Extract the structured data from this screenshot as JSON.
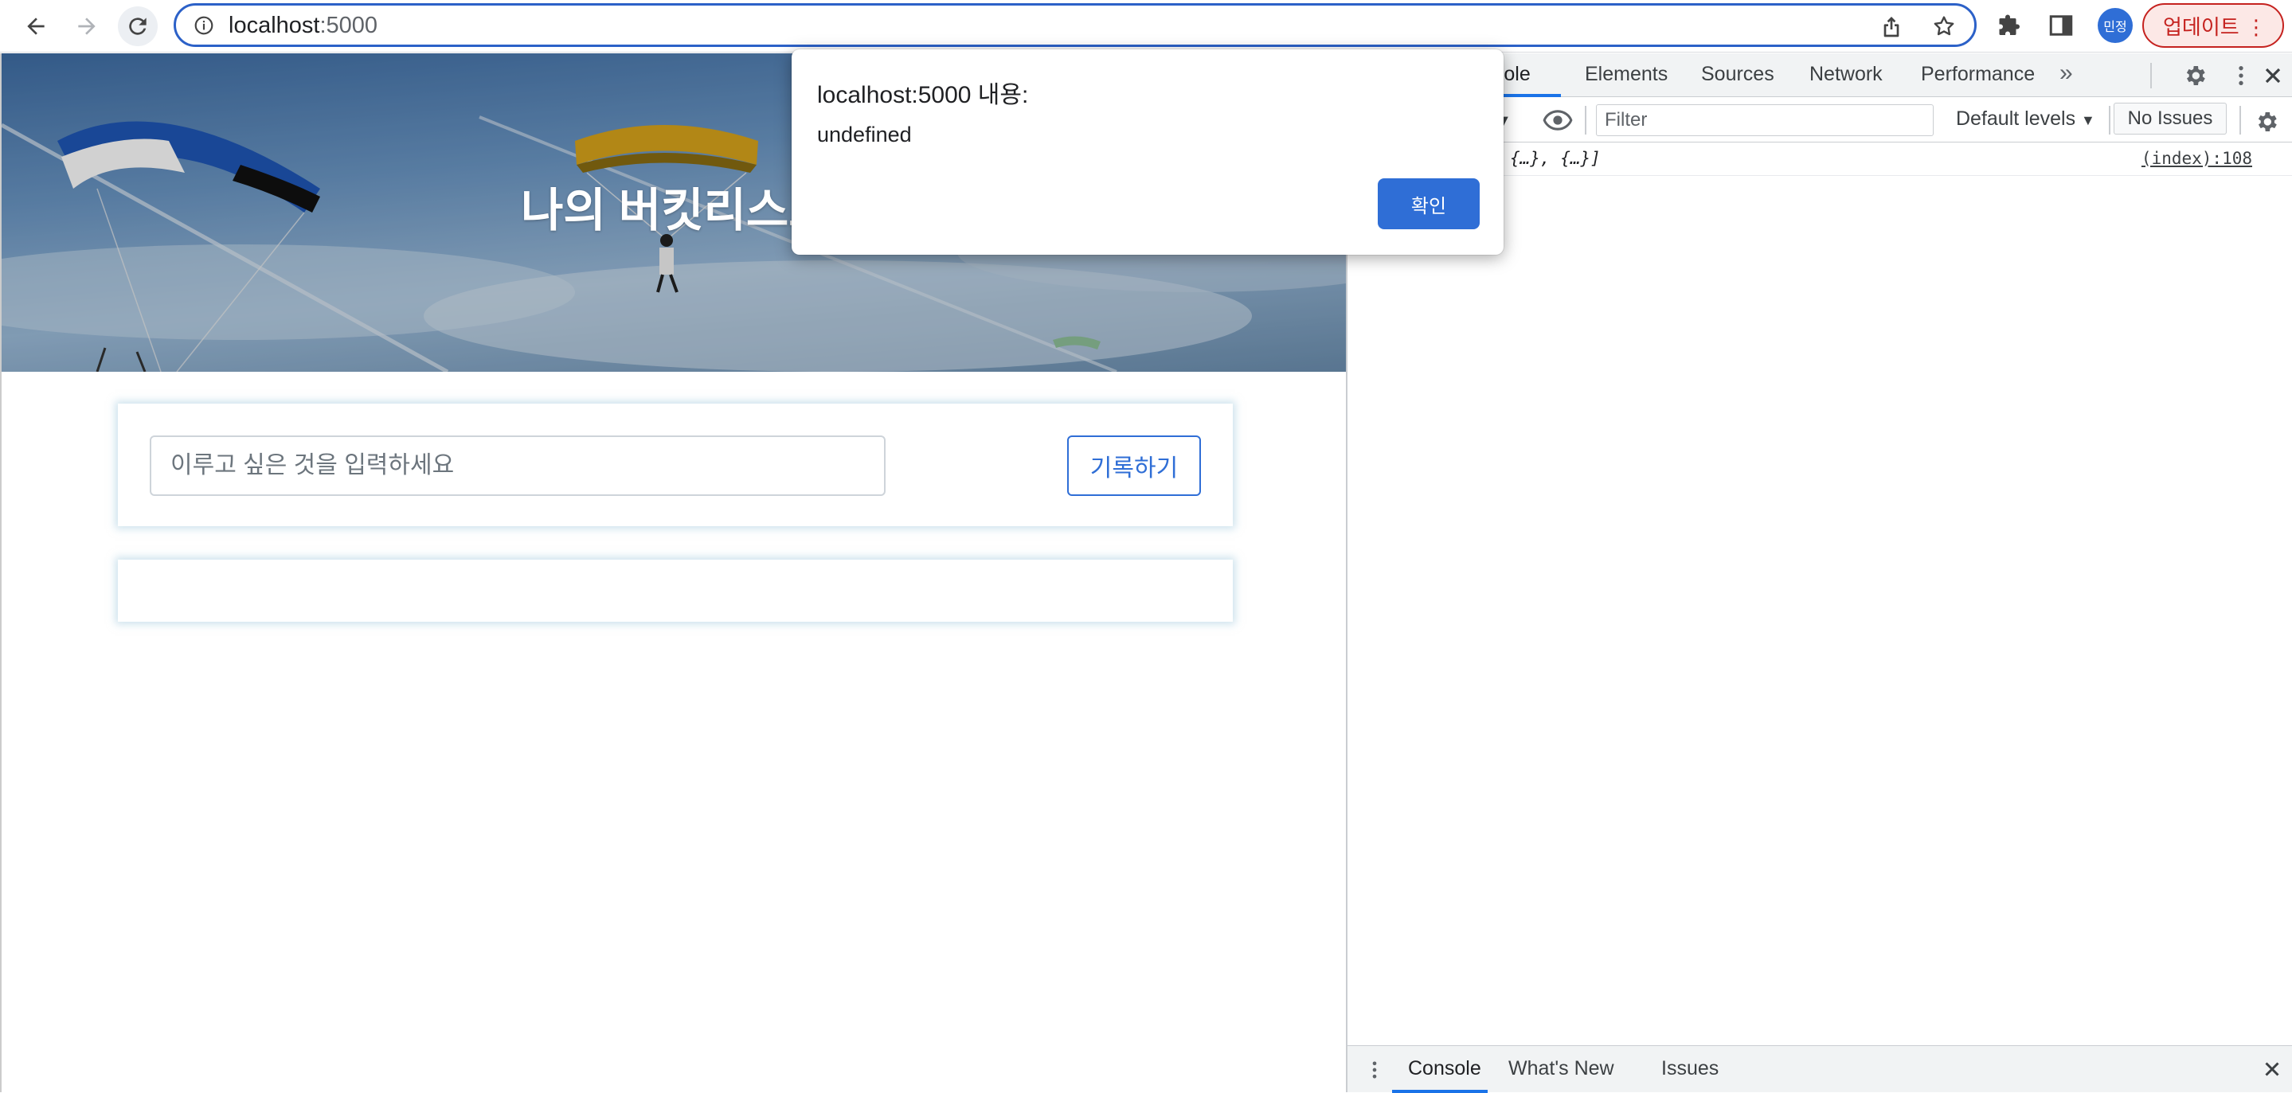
{
  "browser": {
    "url_host": "localhost",
    "url_port": ":5000",
    "profile_initials": "민정",
    "update_label": "업데이트"
  },
  "page": {
    "hero_title": "나의 버킷리스트",
    "input_placeholder": "이루고 싶은 것을 입력하세요",
    "record_button": "기록하기"
  },
  "dialog": {
    "title": "localhost:5000 내용:",
    "message": "undefined",
    "ok_label": "확인"
  },
  "devtools": {
    "tabs": [
      {
        "label": "Console",
        "visible_text": "nsole",
        "active": true
      },
      {
        "label": "Elements"
      },
      {
        "label": "Sources"
      },
      {
        "label": "Network"
      },
      {
        "label": "Performance"
      }
    ],
    "filter_placeholder": "Filter",
    "levels_label": "Default levels",
    "issues_label": "No Issues",
    "log_message": "{…}, {…}]",
    "log_source": "(index):108",
    "drawer_tabs": [
      {
        "label": "Console",
        "active": true
      },
      {
        "label": "What's New"
      },
      {
        "label": "Issues"
      }
    ]
  },
  "colors": {
    "accent": "#2f6ed6",
    "omnibox_border": "#2c61c8",
    "update_red": "#c5221f"
  },
  "icons": [
    "back-icon",
    "forward-icon",
    "reload-icon",
    "info-icon",
    "share-icon",
    "star-icon",
    "extensions-icon",
    "side-panel-icon",
    "more-icon",
    "gear-icon",
    "kebab-icon",
    "close-icon",
    "eye-icon"
  ]
}
